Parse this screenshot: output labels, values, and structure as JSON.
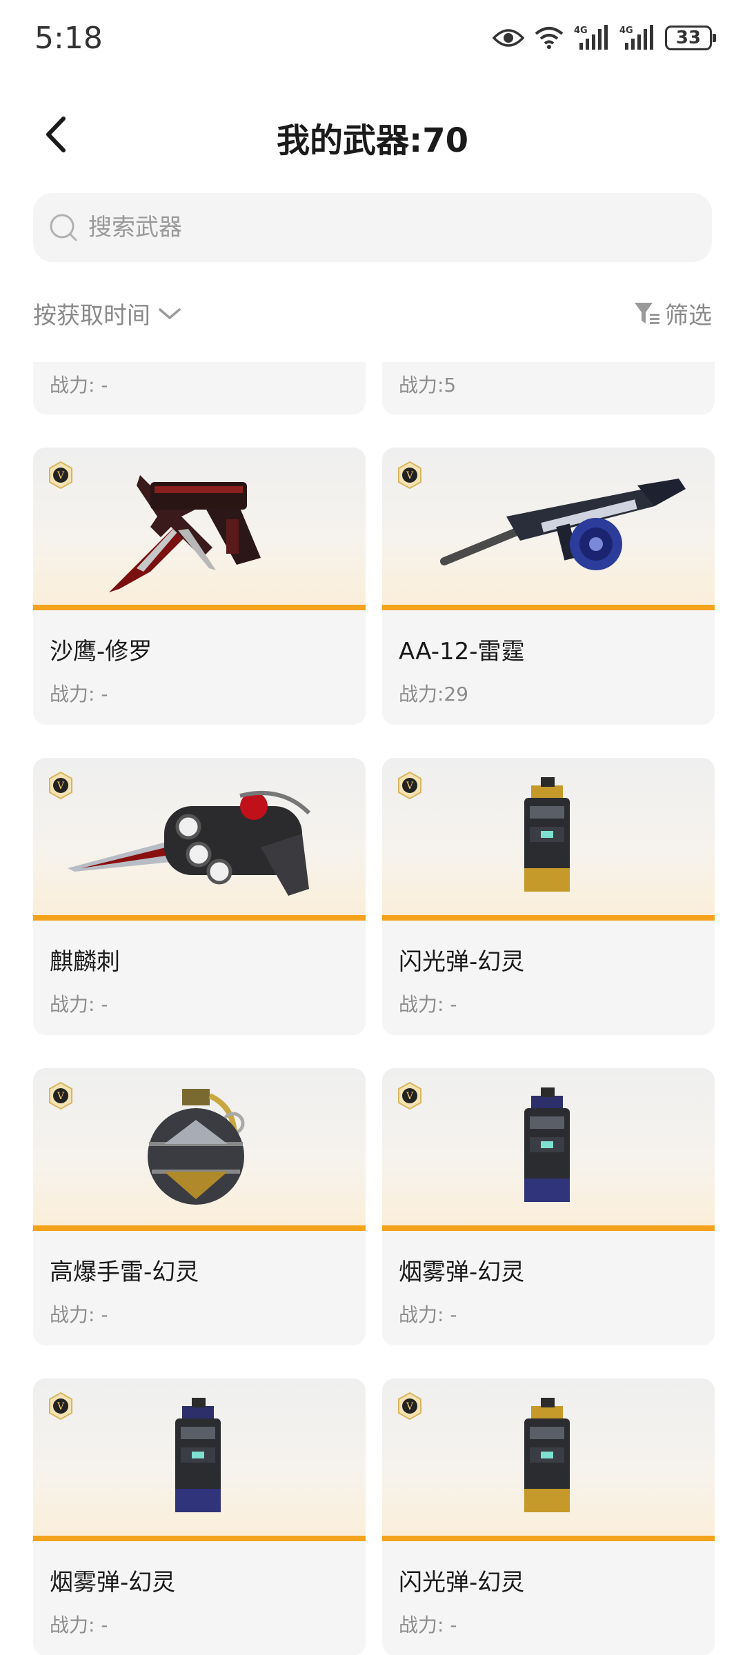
{
  "status": {
    "time": "5:18",
    "battery": "33"
  },
  "header": {
    "title": "我的武器:70"
  },
  "search": {
    "placeholder": "搜索武器"
  },
  "toolbar": {
    "sort_label": "按获取时间",
    "filter_label": "筛选"
  },
  "partial_row": [
    {
      "power": "战力: -"
    },
    {
      "power": "战力:5"
    }
  ],
  "weapons": [
    {
      "name": "沙鹰-修罗",
      "power": "战力: -",
      "icon": "desert-eagle-icon"
    },
    {
      "name": "AA-12-雷霆",
      "power": "战力:29",
      "icon": "shotgun-icon"
    },
    {
      "name": "麒麟刺",
      "power": "战力: -",
      "icon": "knuckle-dagger-icon"
    },
    {
      "name": "闪光弹-幻灵",
      "power": "战力: -",
      "icon": "flashbang-icon"
    },
    {
      "name": "高爆手雷-幻灵",
      "power": "战力: -",
      "icon": "grenade-icon"
    },
    {
      "name": "烟雾弹-幻灵",
      "power": "战力: -",
      "icon": "smoke-grenade-icon"
    },
    {
      "name": "烟雾弹-幻灵",
      "power": "战力: -",
      "icon": "smoke-grenade-icon"
    },
    {
      "name": "闪光弹-幻灵",
      "power": "战力: -",
      "icon": "flashbang-icon"
    }
  ],
  "colors": {
    "accent_stripe": "#f3a21c",
    "card_bg": "#f5f5f5",
    "search_bg": "#f4f4f4"
  }
}
